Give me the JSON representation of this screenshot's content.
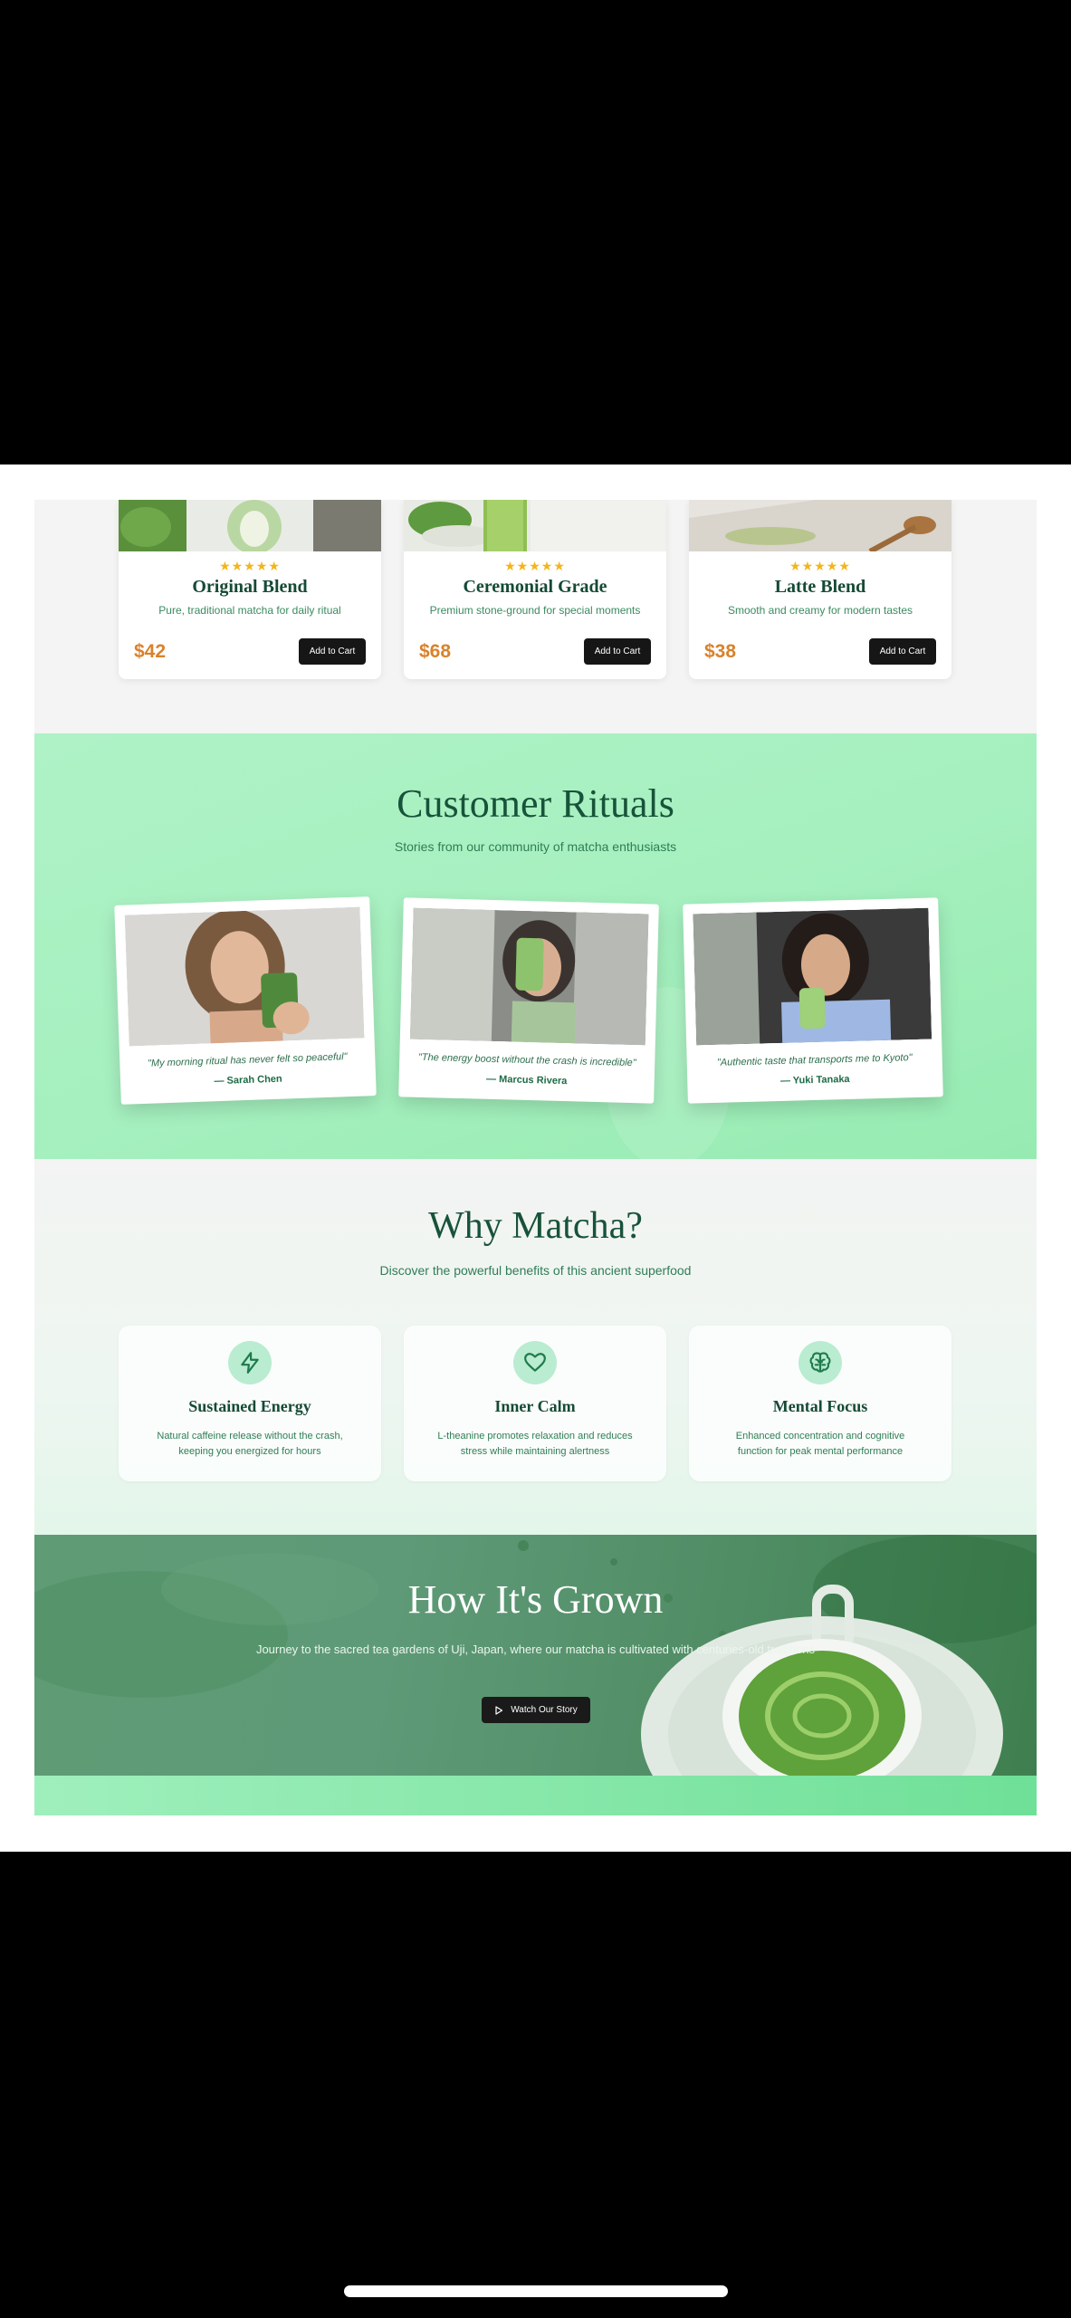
{
  "products": [
    {
      "stars": "★★★★★",
      "name": "Original Blend",
      "desc": "Pure, traditional matcha for daily ritual",
      "price": "$42",
      "cta": "Add to Cart"
    },
    {
      "stars": "★★★★★",
      "name": "Ceremonial Grade",
      "desc": "Premium stone-ground for special moments",
      "price": "$68",
      "cta": "Add to Cart"
    },
    {
      "stars": "★★★★★",
      "name": "Latte Blend",
      "desc": "Smooth and creamy for modern tastes",
      "price": "$38",
      "cta": "Add to Cart"
    }
  ],
  "rituals": {
    "title": "Customer Rituals",
    "subtitle": "Stories from our community of matcha enthusiasts",
    "items": [
      {
        "quote": "\"My morning ritual has never felt so peaceful\"",
        "author": "— Sarah Chen"
      },
      {
        "quote": "\"The energy boost without the crash is incredible\"",
        "author": "— Marcus Rivera"
      },
      {
        "quote": "\"Authentic taste that transports me to Kyoto\"",
        "author": "— Yuki Tanaka"
      }
    ]
  },
  "why": {
    "title": "Why Matcha?",
    "subtitle": "Discover the powerful benefits of this ancient superfood",
    "benefits": [
      {
        "icon": "lightning-icon",
        "title": "Sustained Energy",
        "desc": "Natural caffeine release without the crash, keeping you energized for hours"
      },
      {
        "icon": "heart-icon",
        "title": "Inner Calm",
        "desc": "L-theanine promotes relaxation and reduces stress while maintaining alertness"
      },
      {
        "icon": "brain-icon",
        "title": "Mental Focus",
        "desc": "Enhanced concentration and cognitive function for peak mental performance"
      }
    ]
  },
  "grown": {
    "title": "How It's Grown",
    "desc": "Journey to the sacred tea gardens of Uji, Japan, where our matcha is cultivated with centuries-old traditions",
    "cta": "Watch Our Story"
  },
  "colors": {
    "accent": "#17533a",
    "price": "#d9822b",
    "star": "#f2b51c",
    "mint": "#a6f0bf"
  }
}
